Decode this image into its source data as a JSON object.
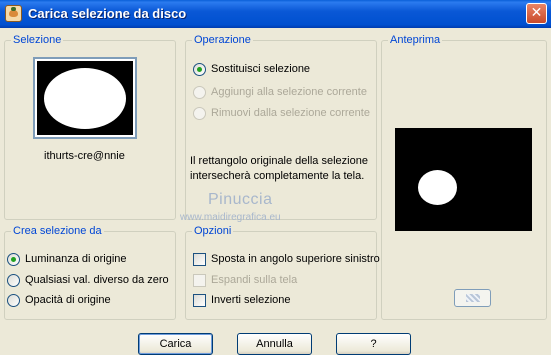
{
  "window": {
    "title": "Carica selezione da disco",
    "close_glyph": "✕"
  },
  "selezione": {
    "legend": "Selezione",
    "name": "ithurts-cre@nnie"
  },
  "operazione": {
    "legend": "Operazione",
    "options": [
      {
        "label": "Sostituisci selezione",
        "checked": true,
        "enabled": true
      },
      {
        "label": "Aggiungi alla selezione corrente",
        "checked": false,
        "enabled": false
      },
      {
        "label": "Rimuovi dalla selezione corrente",
        "checked": false,
        "enabled": false
      }
    ],
    "info_line1": "Il rettangolo originale della selezione",
    "info_line2": "intersecherà completamente la tela."
  },
  "anteprima": {
    "legend": "Anteprima"
  },
  "crea": {
    "legend": "Crea selezione da",
    "options": [
      {
        "label": "Luminanza di origine",
        "checked": true
      },
      {
        "label": "Qualsiasi val. diverso da zero",
        "checked": false
      },
      {
        "label": "Opacità di origine",
        "checked": false
      }
    ]
  },
  "opzioni": {
    "legend": "Opzioni",
    "items": [
      {
        "label": "Sposta in angolo superiore sinistro",
        "checked": false,
        "enabled": true
      },
      {
        "label": "Espandi sulla tela",
        "checked": false,
        "enabled": false
      },
      {
        "label": "Inverti selezione",
        "checked": false,
        "enabled": true
      }
    ]
  },
  "watermark": {
    "line1": "Pinuccia",
    "line2": "www.maidiregrafica.eu"
  },
  "buttons": {
    "load": "Carica",
    "cancel": "Annulla",
    "help": "?"
  },
  "colors": {
    "title_bar": "#0050d0",
    "legend_text": "#0046d5",
    "face": "#ece9d8"
  }
}
